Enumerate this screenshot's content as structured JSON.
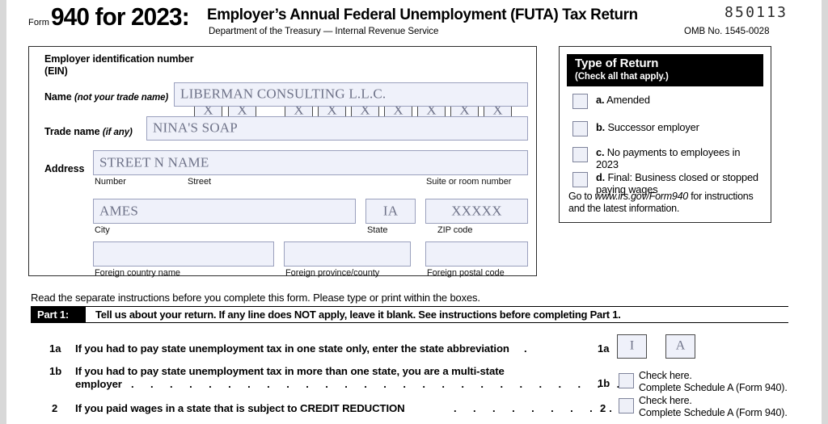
{
  "masthead": {
    "form_word": "Form",
    "form_number": "940 for 2023:",
    "title": "Employer’s Annual Federal Unemployment (FUTA) Tax Return",
    "subtitle": "Department of the Treasury — Internal Revenue Service",
    "ocr_number": "850113",
    "omb": "OMB No. 1545-0028"
  },
  "employer": {
    "ein_label_line1": "Employer identification number",
    "ein_label_line2": "(EIN)",
    "ein_digits": [
      "X",
      "X",
      "X",
      "X",
      "X",
      "X",
      "X",
      "X",
      "X"
    ],
    "name_label": "Name",
    "name_label_italic": "(not your trade name)",
    "name_value": "LIBERMAN CONSULTING L.L.C.",
    "trade_label": "Trade name",
    "trade_label_italic": "(if any)",
    "trade_value": "NINA'S SOAP",
    "address_label": "Address",
    "street_value": "STREET N NAME",
    "sub_number": "Number",
    "sub_street": "Street",
    "sub_suite": "Suite or room number",
    "city_value": "AMES",
    "state_value": "IA",
    "zip_value": "XXXXX",
    "sub_city": "City",
    "sub_state": "State",
    "sub_zip": "ZIP code",
    "foreign_country_value": "",
    "foreign_province_value": "",
    "foreign_postal_value": "",
    "sub_foreign_country": "Foreign country name",
    "sub_foreign_province": "Foreign province/county",
    "sub_foreign_postal": "Foreign postal code"
  },
  "type_of_return": {
    "title": "Type of Return",
    "subtitle": "(Check all that apply.)",
    "options": [
      {
        "key": "a.",
        "text": "Amended",
        "checked": false
      },
      {
        "key": "b.",
        "text": "Successor employer",
        "checked": false
      },
      {
        "key": "c.",
        "text": "No payments to employees in 2023",
        "checked": false
      },
      {
        "key": "d.",
        "text": "Final: Business closed or stopped paying wages",
        "checked": false
      }
    ],
    "goto_prefix": "Go to ",
    "goto_url": "www.irs.gov/Form940",
    "goto_suffix": " for instructions and the latest information."
  },
  "instructions": {
    "read_line": "Read the separate instructions before you complete this form. Please type or print within the boxes.",
    "part_tag": "Part 1:",
    "part_text": "Tell us about your return. If any line does NOT apply, leave it blank. See instructions before completing Part 1."
  },
  "lines": {
    "l1a": {
      "number": "1a",
      "text": "If you had to pay state unemployment tax in one state only, enter the state abbreviation",
      "ref": "1a",
      "state_boxes": [
        "I",
        "A"
      ]
    },
    "l1b": {
      "number": "1b",
      "text_line1": "If you had to pay state unemployment tax in more than one state, you are a multi-state",
      "text_line2": "employer",
      "ref": "1b",
      "check_line1": "Check here.",
      "check_line2": "Complete Schedule A (Form 940).",
      "checked": false
    },
    "l2": {
      "number": "2",
      "text": "If you paid wages in a state that is subject to CREDIT REDUCTION",
      "ref": "2",
      "check_line1": "Check here.",
      "check_line2": "Complete Schedule A (Form 940).",
      "checked": false
    }
  },
  "colors": {
    "field_fill": "#eff1fa",
    "field_border": "#9aa0bd",
    "field_text": "#6e7288",
    "page_bg": "#ffffff",
    "outer_bg": "#d8d8d8",
    "black": "#000000"
  }
}
